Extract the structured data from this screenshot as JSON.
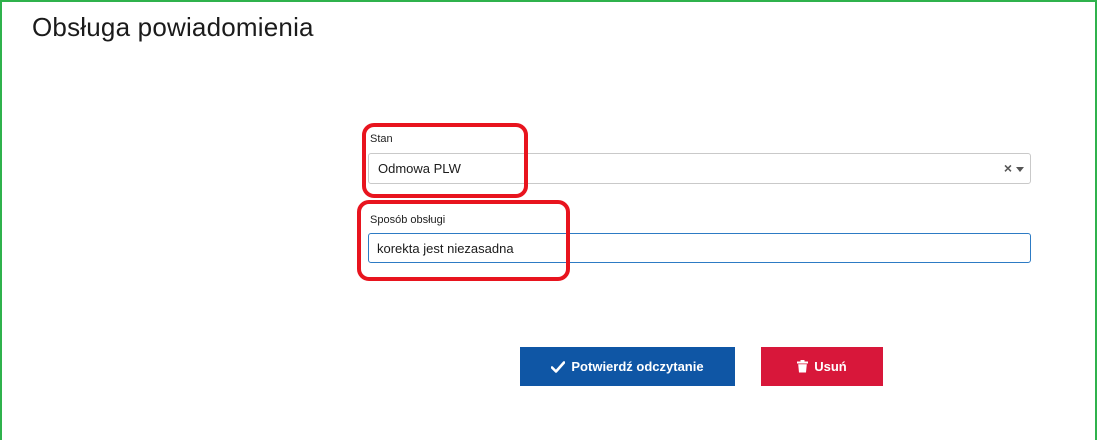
{
  "page": {
    "title": "Obsługa powiadomienia"
  },
  "form": {
    "stan": {
      "label": "Stan",
      "value": "Odmowa PLW",
      "clear_icon": "×"
    },
    "sposob": {
      "label": "Sposób obsługi",
      "value": "korekta jest niezasadna"
    }
  },
  "actions": {
    "confirm_label": "Potwierdź odczytanie",
    "confirm_icon": "checkmark-icon",
    "delete_label": "Usuń",
    "delete_icon": "trash-icon"
  },
  "colors": {
    "frame": "#2fb24c",
    "highlight": "#e8141e",
    "confirm_button": "#0f56a5",
    "delete_button": "#d8173a",
    "input_focus_border": "#2d7bc4"
  }
}
